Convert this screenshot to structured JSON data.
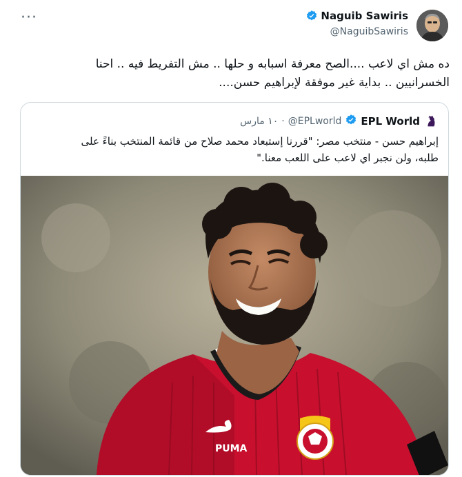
{
  "tweet": {
    "more_label": "···",
    "author_name": "Naguib Sawiris",
    "author_handle": "@NaguibSawiris",
    "text_line1": "ده مش اي لاعب ....الصح معرفة اسبابه و حلها .. مش التفريط فيه .. احنا",
    "text_line2": "الخسرانيين .. بداية غير موفقة لإبراهيم حسن....",
    "accent_color": "#1d9bf0"
  },
  "quote": {
    "name": "EPL World",
    "handle": "@EPLworld",
    "date": "١٠ مارس",
    "separator": "·",
    "text_line1": "إبراهيم حسن - منتخب مصر: \"قررنا إستبعاد محمد صلاح من قائمة المنتخب بناءً على",
    "text_line2": "طلبه، ولن نجبر اي لاعب على اللعب معنا.\"",
    "brand_color": "#3d195b"
  },
  "photo": {
    "jersey_brand": "PUMA"
  }
}
